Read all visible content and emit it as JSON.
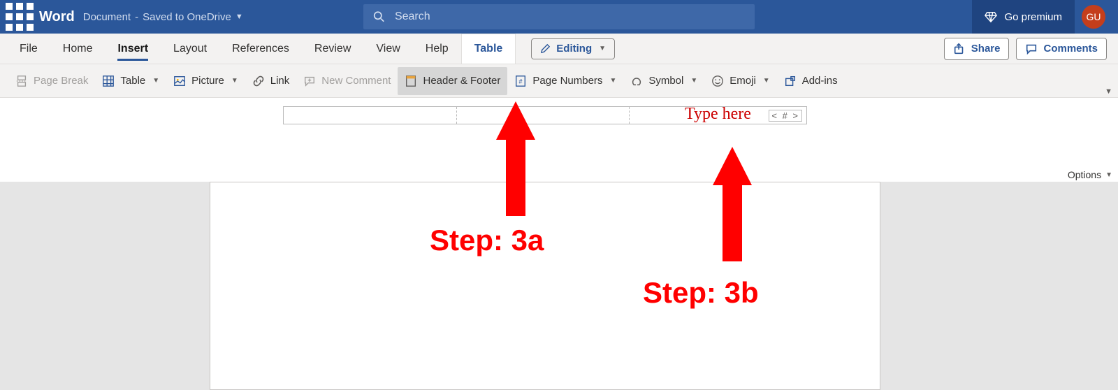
{
  "titlebar": {
    "app_name": "Word",
    "doc_name": "Document",
    "save_status": "Saved to OneDrive",
    "search_placeholder": "Search",
    "go_premium": "Go premium",
    "user_initials": "GU"
  },
  "tabs": {
    "file": "File",
    "home": "Home",
    "insert": "Insert",
    "layout": "Layout",
    "references": "References",
    "review": "Review",
    "view": "View",
    "help": "Help",
    "table": "Table",
    "editing": "Editing",
    "share": "Share",
    "comments": "Comments"
  },
  "ribbon": {
    "page_break": "Page Break",
    "table": "Table",
    "picture": "Picture",
    "link": "Link",
    "new_comment": "New Comment",
    "header_footer": "Header & Footer",
    "page_numbers": "Page Numbers",
    "symbol": "Symbol",
    "emoji": "Emoji",
    "addins": "Add-ins"
  },
  "header_area": {
    "type_here": "Type here",
    "page_num_token": "< # >",
    "options": "Options"
  },
  "annotations": {
    "step_3a": "Step: 3a",
    "step_3b": "Step: 3b"
  }
}
